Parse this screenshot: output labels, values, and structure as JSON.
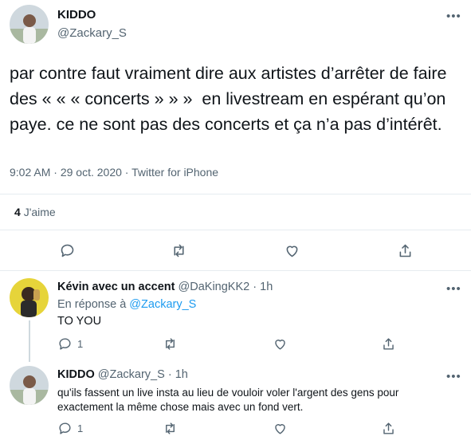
{
  "colors": {
    "accent": "#1d9bf0",
    "muted": "#536471",
    "divider": "#e6ecf0"
  },
  "main_tweet": {
    "author": {
      "name": "KIDDO",
      "handle": "@Zackary_S",
      "avatar_icon": "avatar-photo"
    },
    "text": "par contre faut vraiment dire aux artistes d’arrêter de faire des « « « concerts » » »  en livestream en espérant qu’on paye. ce ne sont pas des concerts et ça n’a pas d’intérêt.",
    "time": "9:02 AM",
    "sep1": "·",
    "date": "29 oct. 2020",
    "sep2": "·",
    "source": "Twitter for iPhone",
    "likes_count": "4",
    "likes_label": "J'aime",
    "more_icon": "more-icon"
  },
  "replies": [
    {
      "name": "Kévin avec un accent",
      "handle": "@DaKingKK2",
      "sep": "·",
      "time": "1h",
      "reply_to_label": "En réponse à",
      "reply_to_handle": "@Zackary_S",
      "text": "TO YOU",
      "reply_count": "1"
    },
    {
      "name": "KIDDO",
      "handle": "@Zackary_S",
      "sep": "·",
      "time": "1h",
      "text": "qu'ils fassent un live insta au lieu de vouloir voler l'argent des gens pour exactement la même chose mais avec un fond vert.",
      "reply_count": "1"
    }
  ]
}
